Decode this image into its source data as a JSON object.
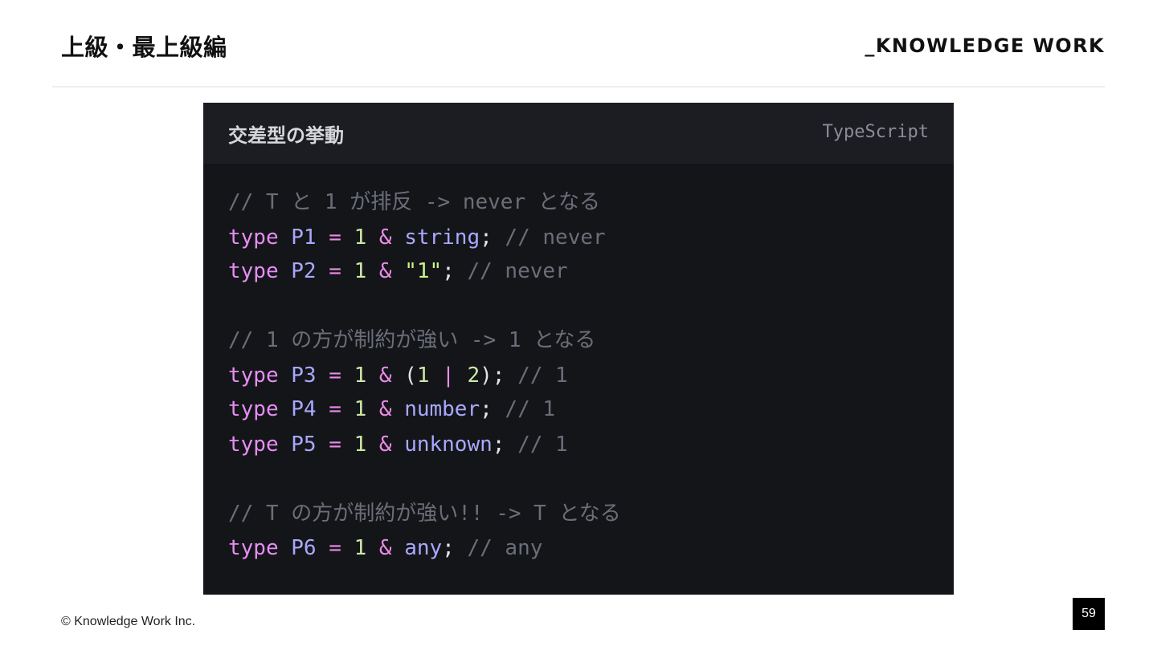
{
  "header": {
    "title": "上級・最上級編",
    "brand": "_KNOWLEDGE WORK"
  },
  "code_block": {
    "title": "交差型の挙動",
    "language": "TypeScript",
    "lines": [
      {
        "tokens": [
          {
            "t": "comment",
            "v": "// T と 1 が排反 -> never となる"
          }
        ]
      },
      {
        "tokens": [
          {
            "t": "keyword",
            "v": "type"
          },
          {
            "t": "punct",
            "v": " "
          },
          {
            "t": "ident",
            "v": "P1"
          },
          {
            "t": "punct",
            "v": " "
          },
          {
            "t": "op",
            "v": "="
          },
          {
            "t": "punct",
            "v": " "
          },
          {
            "t": "num",
            "v": "1"
          },
          {
            "t": "punct",
            "v": " "
          },
          {
            "t": "op",
            "v": "&"
          },
          {
            "t": "punct",
            "v": " "
          },
          {
            "t": "type",
            "v": "string"
          },
          {
            "t": "punct",
            "v": "; "
          },
          {
            "t": "comment",
            "v": "// never"
          }
        ]
      },
      {
        "tokens": [
          {
            "t": "keyword",
            "v": "type"
          },
          {
            "t": "punct",
            "v": " "
          },
          {
            "t": "ident",
            "v": "P2"
          },
          {
            "t": "punct",
            "v": " "
          },
          {
            "t": "op",
            "v": "="
          },
          {
            "t": "punct",
            "v": " "
          },
          {
            "t": "num",
            "v": "1"
          },
          {
            "t": "punct",
            "v": " "
          },
          {
            "t": "op",
            "v": "&"
          },
          {
            "t": "punct",
            "v": " "
          },
          {
            "t": "string",
            "v": "\"1\""
          },
          {
            "t": "punct",
            "v": "; "
          },
          {
            "t": "comment",
            "v": "// never"
          }
        ]
      },
      {
        "tokens": []
      },
      {
        "tokens": [
          {
            "t": "comment",
            "v": "// 1 の方が制約が強い -> 1 となる"
          }
        ]
      },
      {
        "tokens": [
          {
            "t": "keyword",
            "v": "type"
          },
          {
            "t": "punct",
            "v": " "
          },
          {
            "t": "ident",
            "v": "P3"
          },
          {
            "t": "punct",
            "v": " "
          },
          {
            "t": "op",
            "v": "="
          },
          {
            "t": "punct",
            "v": " "
          },
          {
            "t": "num",
            "v": "1"
          },
          {
            "t": "punct",
            "v": " "
          },
          {
            "t": "op",
            "v": "&"
          },
          {
            "t": "punct",
            "v": " ("
          },
          {
            "t": "num",
            "v": "1"
          },
          {
            "t": "punct",
            "v": " "
          },
          {
            "t": "op",
            "v": "|"
          },
          {
            "t": "punct",
            "v": " "
          },
          {
            "t": "num",
            "v": "2"
          },
          {
            "t": "punct",
            "v": "); "
          },
          {
            "t": "comment",
            "v": "// 1"
          }
        ]
      },
      {
        "tokens": [
          {
            "t": "keyword",
            "v": "type"
          },
          {
            "t": "punct",
            "v": " "
          },
          {
            "t": "ident",
            "v": "P4"
          },
          {
            "t": "punct",
            "v": " "
          },
          {
            "t": "op",
            "v": "="
          },
          {
            "t": "punct",
            "v": " "
          },
          {
            "t": "num",
            "v": "1"
          },
          {
            "t": "punct",
            "v": " "
          },
          {
            "t": "op",
            "v": "&"
          },
          {
            "t": "punct",
            "v": " "
          },
          {
            "t": "type",
            "v": "number"
          },
          {
            "t": "punct",
            "v": "; "
          },
          {
            "t": "comment",
            "v": "// 1"
          }
        ]
      },
      {
        "tokens": [
          {
            "t": "keyword",
            "v": "type"
          },
          {
            "t": "punct",
            "v": " "
          },
          {
            "t": "ident",
            "v": "P5"
          },
          {
            "t": "punct",
            "v": " "
          },
          {
            "t": "op",
            "v": "="
          },
          {
            "t": "punct",
            "v": " "
          },
          {
            "t": "num",
            "v": "1"
          },
          {
            "t": "punct",
            "v": " "
          },
          {
            "t": "op",
            "v": "&"
          },
          {
            "t": "punct",
            "v": " "
          },
          {
            "t": "type",
            "v": "unknown"
          },
          {
            "t": "punct",
            "v": "; "
          },
          {
            "t": "comment",
            "v": "// 1"
          }
        ]
      },
      {
        "tokens": []
      },
      {
        "tokens": [
          {
            "t": "comment",
            "v": "// T の方が制約が強い!! -> T となる"
          }
        ]
      },
      {
        "tokens": [
          {
            "t": "keyword",
            "v": "type"
          },
          {
            "t": "punct",
            "v": " "
          },
          {
            "t": "ident",
            "v": "P6"
          },
          {
            "t": "punct",
            "v": " "
          },
          {
            "t": "op",
            "v": "="
          },
          {
            "t": "punct",
            "v": " "
          },
          {
            "t": "num",
            "v": "1"
          },
          {
            "t": "punct",
            "v": " "
          },
          {
            "t": "op",
            "v": "&"
          },
          {
            "t": "punct",
            "v": " "
          },
          {
            "t": "type",
            "v": "any"
          },
          {
            "t": "punct",
            "v": "; "
          },
          {
            "t": "comment",
            "v": "// any"
          }
        ]
      }
    ]
  },
  "footer": {
    "copyright": "© Knowledge Work Inc.",
    "page_number": "59"
  }
}
